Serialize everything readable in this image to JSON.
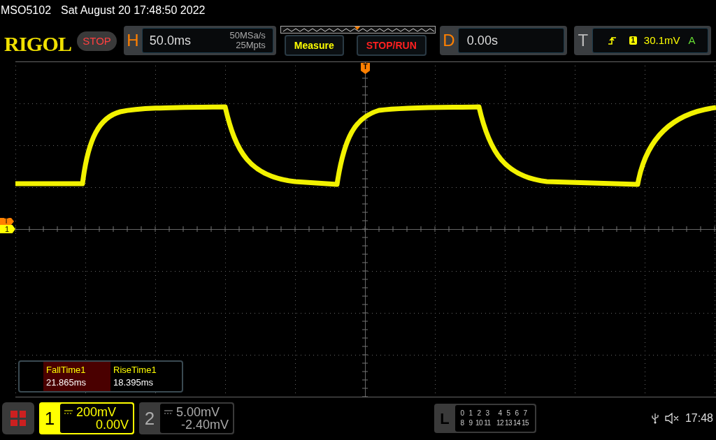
{
  "header": {
    "model": "MSO5102",
    "datetime": "Sat August 20 17:48:50 2022"
  },
  "toolbar": {
    "logo": "RIGOL",
    "run_state": "STOP",
    "horizontal": {
      "label": "H",
      "timebase": "50.0ms",
      "sample_rate": "50MSa/s",
      "memory_depth": "25Mpts"
    },
    "buttons": [
      {
        "label": "Measure",
        "kind": "measure"
      },
      {
        "label": "STOP/RUN",
        "kind": "stoprun"
      }
    ],
    "delay": {
      "label": "D",
      "value": "0.00s"
    },
    "trigger": {
      "label": "T",
      "source": "1",
      "level": "30.1mV",
      "mode": "A"
    }
  },
  "screen": {
    "trigger_position_marker": "T",
    "trigger_level_marker": "T",
    "channel_marker": "1"
  },
  "measurements": [
    {
      "name": "FallTime1",
      "value": "21.865ms",
      "selected": true
    },
    {
      "name": "RiseTime1",
      "value": "18.395ms",
      "selected": false
    }
  ],
  "channels": [
    {
      "number": "1",
      "scale": "200mV",
      "offset": "0.00V",
      "active": true
    },
    {
      "number": "2",
      "scale": "5.00mV",
      "offset": "-2.40mV",
      "active": false
    }
  ],
  "logic": {
    "label": "L",
    "rows": [
      [
        "0",
        "1",
        "2",
        "3",
        "4",
        "5",
        "6",
        "7"
      ],
      [
        "8",
        "9",
        "10",
        "11",
        "12",
        "13",
        "14",
        "15"
      ]
    ]
  },
  "status": {
    "time": "17:48"
  }
}
